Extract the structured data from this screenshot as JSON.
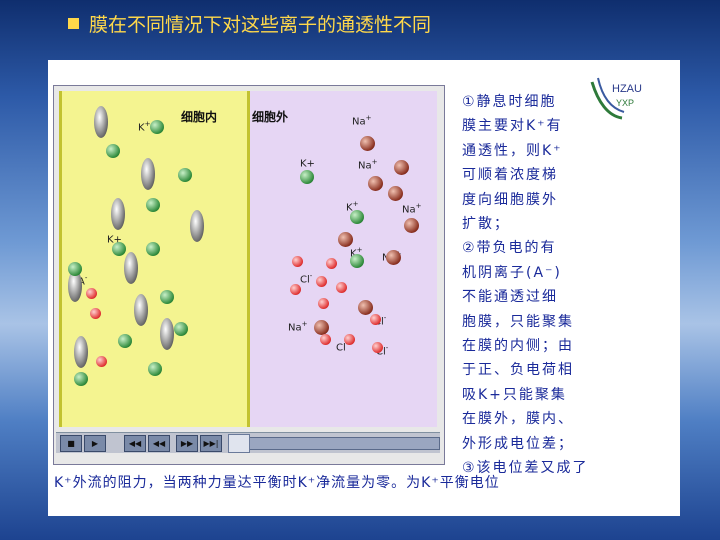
{
  "title": "膜在不同情况下对这些离子的通透性不同",
  "logo": {
    "text_top": "HZAU",
    "text_bottom": "YXP"
  },
  "panel": {
    "inside_label": "细胞内",
    "outside_label": "细胞外",
    "inside_ions": [
      {
        "t": "K",
        "s": "+"
      },
      {
        "t": "K+",
        "s": ""
      },
      {
        "t": "A",
        "s": "-"
      }
    ],
    "outside_ions": [
      {
        "t": "Na",
        "s": "+"
      },
      {
        "t": "K+",
        "s": ""
      },
      {
        "t": "Na",
        "s": "+"
      },
      {
        "t": "K",
        "s": "+"
      },
      {
        "t": "Na",
        "s": "+"
      },
      {
        "t": "K",
        "s": "+"
      },
      {
        "t": "Na",
        "s": "+"
      },
      {
        "t": "Cl",
        "s": "-"
      },
      {
        "t": "Na",
        "s": "+"
      },
      {
        "t": "Cl",
        "s": "-"
      },
      {
        "t": "Cl",
        "s": "-"
      },
      {
        "t": "Cl",
        "s": "-"
      }
    ]
  },
  "side_lines": [
    "①静息时细胞",
    "膜主要对K⁺有",
    "通透性，则K⁺",
    "可顺着浓度梯",
    "度向细胞膜外",
    "扩散；",
    "②带负电的有",
    "机阴离子(A⁻)",
    "不能通透过细",
    "胞膜，只能聚集",
    "在膜的内侧；由",
    "于正、负电荷相",
    "吸K+只能聚集",
    "在膜外，膜内、",
    "外形成电位差；",
    "③该电位差又成了"
  ],
  "bottom_text": "K⁺外流的阻力，当两种力量达平衡时K⁺净流量为零。为K⁺平衡电位",
  "controls": [
    "■",
    "▶",
    "◀◀",
    "◀◀",
    "▶▶",
    "▶▶|"
  ],
  "playback_position": 0.0
}
